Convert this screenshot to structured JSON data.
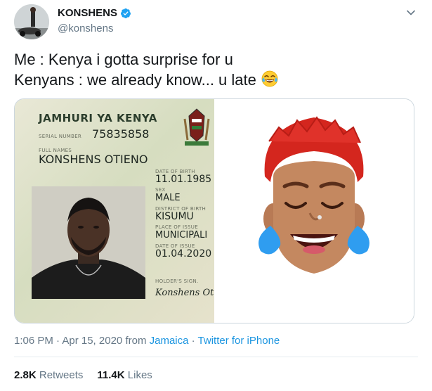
{
  "tweet": {
    "display_name": "KONSHENS",
    "handle": "@konshens",
    "text_line1": "Me : Kenya i gotta surprise for u",
    "text_line2": "Kenyans : we already know... u late",
    "emoji": "😂",
    "timestamp": "1:06 PM · Apr 15, 2020",
    "from_label": "from",
    "location": "Jamaica",
    "separator": "·",
    "client": "Twitter for iPhone",
    "retweets_count": "2.8K",
    "retweets_label": "Retweets",
    "likes_count": "11.4K",
    "likes_label": "Likes"
  },
  "id_card": {
    "header": "JAMHURI YA KENYA",
    "serial_label": "SERIAL NUMBER",
    "serial_number": "75835858",
    "full_names_label": "FULL NAMES",
    "full_names": "KONSHENS OTIENO",
    "dob_label": "DATE OF BIRTH",
    "dob": "11.01.1985",
    "sex_label": "SEX",
    "sex": "MALE",
    "district_label": "DISTRICT OF BIRTH",
    "district": "KISUMU",
    "issue_place_label": "PLACE OF ISSUE",
    "issue_place": "MUNICIPALI",
    "issue_date_label": "DATE OF ISSUE",
    "issue_date": "01.04.2020",
    "sign_label": "HOLDER'S SIGN.",
    "signature": "Konshens Ot"
  },
  "icons": {
    "verified": "verified-badge-icon",
    "caret": "chevron-down-icon",
    "emoji": "face-with-tears-of-joy"
  },
  "colors": {
    "verified": "#1da1f2",
    "link": "#1b95e0",
    "secondary_text": "#657786"
  }
}
